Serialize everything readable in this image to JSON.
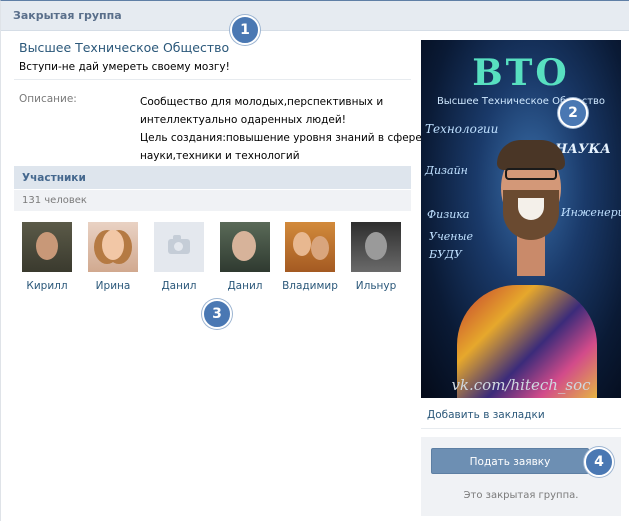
{
  "header": {
    "title": "Закрытая группа"
  },
  "group": {
    "name": "Высшее Техническое Общество",
    "status": "Вступи-не дай умереть своему мозгу!"
  },
  "description": {
    "label": "Описание:",
    "lines": [
      "Сообщество для молодых,перспективных и",
      "интеллектуально одаренных людей!",
      "Цель создания:повышение уровня знаний в сфере",
      "науки,техники и технологий"
    ]
  },
  "members": {
    "title": "Участники",
    "count": "131 человек",
    "list": [
      {
        "name": "Кирилл"
      },
      {
        "name": "Ирина"
      },
      {
        "name": "Данил"
      },
      {
        "name": "Данил"
      },
      {
        "name": "Владимир"
      },
      {
        "name": "Ильнур"
      }
    ]
  },
  "cover": {
    "logo": "BTO",
    "subtitle": "Высшее Техническое Общество",
    "words": [
      "Технологии",
      "НАУКА",
      "Дизайн",
      "Физика",
      "Инженерия",
      "Ученые",
      "БУДУ"
    ],
    "url": "vk.com/hitech_soc"
  },
  "sidebar": {
    "bookmark_label": "Добавить в закладки",
    "apply_label": "Подать заявку",
    "closed_note": "Это закрытая группа."
  },
  "markers": [
    "1",
    "2",
    "3",
    "4"
  ],
  "colors": {
    "link": "#2b587a",
    "accent": "#4a78b3",
    "button": "#6d8fb3",
    "header_bg": "#e6ebf1"
  }
}
